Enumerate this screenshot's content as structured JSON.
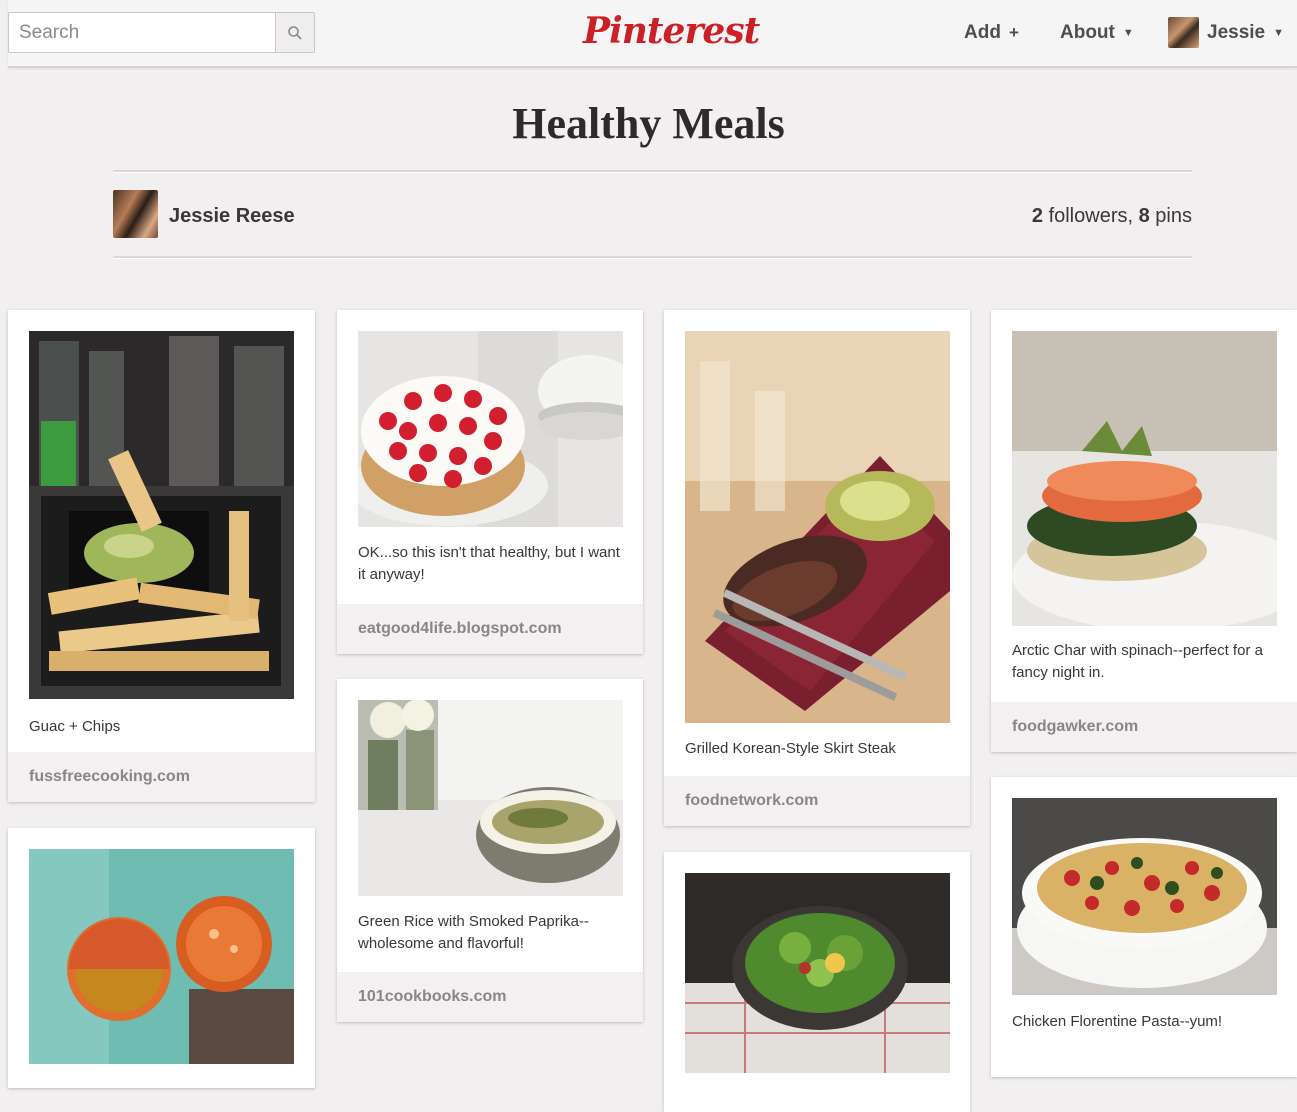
{
  "header": {
    "search_placeholder": "Search",
    "logo": "Pinterest",
    "add_label": "Add",
    "about_label": "About",
    "user_label": "Jessie"
  },
  "board": {
    "title": "Healthy Meals",
    "owner": "Jessie Reese",
    "followers": "2",
    "followers_label": "followers,",
    "pins": "8",
    "pins_label": "pins"
  },
  "pins": [
    {
      "description": "Guac + Chips",
      "source": "fussfreecooking.com"
    },
    {
      "description": "OK...so this isn't that healthy, but I want it anyway!",
      "source": "eatgood4life.blogspot.com"
    },
    {
      "description": "Grilled Korean-Style Skirt Steak",
      "source": "foodnetwork.com"
    },
    {
      "description": "Arctic Char with spinach--perfect for a fancy night in.",
      "source": "foodgawker.com"
    },
    {
      "description": "Green Rice with Smoked Paprika--wholesome and flavorful!",
      "source": "101cookbooks.com"
    },
    {
      "description": "Chicken Florentine Pasta--yum!",
      "source": ""
    }
  ],
  "colors": {
    "brand": "#cb2027",
    "background": "#f1efef"
  }
}
